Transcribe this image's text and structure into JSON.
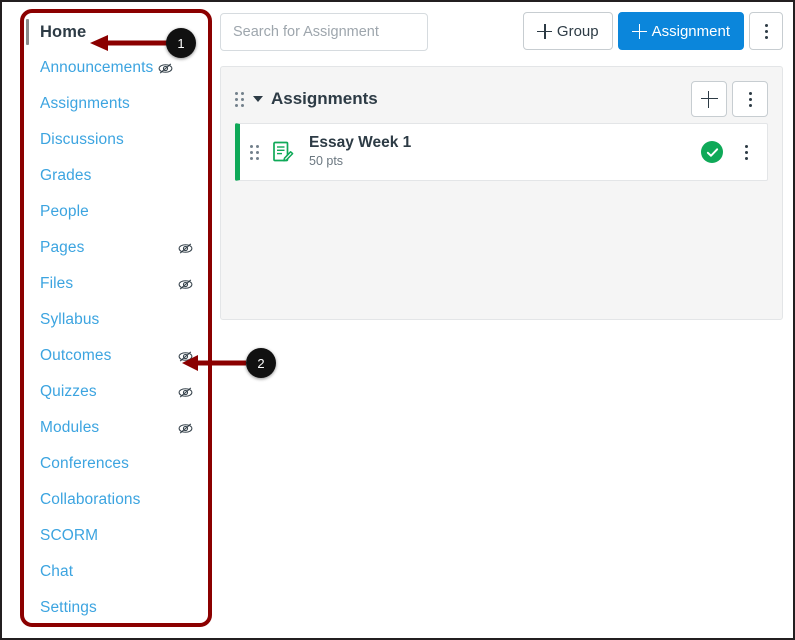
{
  "sidebar": {
    "items": [
      {
        "label": "Home",
        "active": true,
        "hidden_icon": false
      },
      {
        "label": "Announcements",
        "active": false,
        "hidden_icon": true,
        "icon_inline": true
      },
      {
        "label": "Assignments",
        "active": false,
        "hidden_icon": false
      },
      {
        "label": "Discussions",
        "active": false,
        "hidden_icon": false
      },
      {
        "label": "Grades",
        "active": false,
        "hidden_icon": false
      },
      {
        "label": "People",
        "active": false,
        "hidden_icon": false
      },
      {
        "label": "Pages",
        "active": false,
        "hidden_icon": true
      },
      {
        "label": "Files",
        "active": false,
        "hidden_icon": true
      },
      {
        "label": "Syllabus",
        "active": false,
        "hidden_icon": false
      },
      {
        "label": "Outcomes",
        "active": false,
        "hidden_icon": true
      },
      {
        "label": "Quizzes",
        "active": false,
        "hidden_icon": true
      },
      {
        "label": "Modules",
        "active": false,
        "hidden_icon": true
      },
      {
        "label": "Conferences",
        "active": false,
        "hidden_icon": false
      },
      {
        "label": "Collaborations",
        "active": false,
        "hidden_icon": false
      },
      {
        "label": "SCORM",
        "active": false,
        "hidden_icon": false
      },
      {
        "label": "Chat",
        "active": false,
        "hidden_icon": false
      },
      {
        "label": "Settings",
        "active": false,
        "hidden_icon": false
      }
    ],
    "hidden_icon_name": "eye-slash-icon"
  },
  "toolbar": {
    "search_placeholder": "Search for Assignment",
    "search_value": "",
    "add_group_label": "Group",
    "add_assignment_label": "Assignment",
    "more_icon": "kebab-menu-icon",
    "plus_icon": "plus-icon"
  },
  "group": {
    "title": "Assignments",
    "drag_icon": "drag-handle-icon",
    "collapse_icon": "caret-down-icon",
    "add_icon": "plus-icon",
    "more_icon": "kebab-menu-icon",
    "assignments": [
      {
        "title": "Essay Week 1",
        "points": "50 pts",
        "icon": "assignment-icon",
        "published": true,
        "published_icon": "check-circle-icon",
        "more_icon": "kebab-menu-icon"
      }
    ]
  },
  "annotations": {
    "callouts": [
      {
        "number": "1",
        "target": "Home"
      },
      {
        "number": "2",
        "target": "Outcomes"
      }
    ],
    "arrow_color": "#8B0000",
    "box_color": "#8B0000"
  },
  "colors": {
    "link": "#3CA4E0",
    "primary_button": "#0B86DB",
    "published_green": "#0FA958",
    "text": "#2D3B45",
    "panel_bg": "#F5F5F5"
  }
}
